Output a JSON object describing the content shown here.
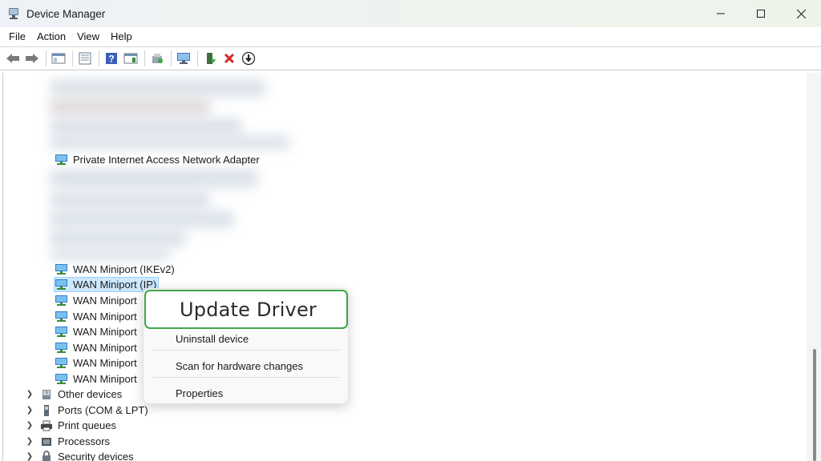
{
  "window": {
    "title": "Device Manager",
    "controls": {
      "minimize": "minimize-icon",
      "maximize": "maximize-icon",
      "close": "close-icon"
    }
  },
  "menubar": {
    "items": [
      "File",
      "Action",
      "View",
      "Help"
    ]
  },
  "toolbar": {
    "icons": [
      "back-arrow-icon",
      "forward-arrow-icon",
      "show-hide-console-tree-icon",
      "properties-icon",
      "help-icon",
      "action-pane-icon",
      "update-driver-icon",
      "scan-hardware-icon",
      "enable-device-icon",
      "uninstall-device-icon",
      "download-driver-icon"
    ]
  },
  "tree": {
    "adapters": [
      "Private Internet Access Network Adapter",
      "WAN Miniport (IKEv2)",
      "WAN Miniport (IP)",
      "WAN Miniport",
      "WAN Miniport",
      "WAN Miniport",
      "WAN Miniport",
      "WAN Miniport",
      "WAN Miniport"
    ],
    "categories": [
      "Other devices",
      "Ports (COM & LPT)",
      "Print queues",
      "Processors",
      "Security devices"
    ]
  },
  "context_menu": {
    "update_driver": "Update Driver",
    "uninstall": "Uninstall device",
    "scan": "Scan for hardware changes",
    "properties": "Properties"
  },
  "colors": {
    "selection": "#cde8ff",
    "highlight_border": "#3ea64a",
    "uninstall_x": "#d9262b"
  }
}
